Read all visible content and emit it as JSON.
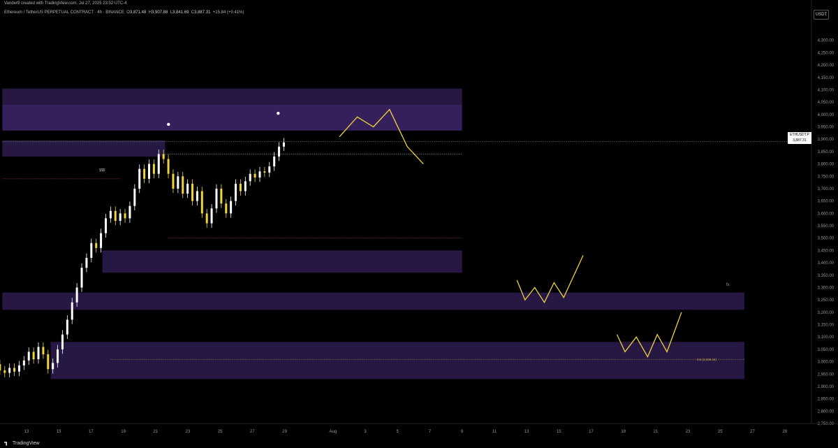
{
  "header": {
    "attribution": "Vander9 created with TradingView.com, Jul 27, 2025 23:02 UTC-4",
    "symbol_line": "Ethereum / TetherUS PERPETUAL CONTRACT · 4h · BINANCE",
    "open_label": "O",
    "open": "3,871.48",
    "high_label": "H",
    "high": "3,907.88",
    "low_label": "L",
    "low": "3,841.69",
    "close_label": "C",
    "close": "3,887.31",
    "change": "+15.84 (+0.41%)"
  },
  "currency": "USDT",
  "price_tag": {
    "symbol": "ETHUSDT.P",
    "price": "3,887.31",
    "countdown": "57:37"
  },
  "annotations": {
    "liquidity": "$$$",
    "fx": "fx",
    "fib": "0.5 (3,009.44)"
  },
  "brand": "TradingView",
  "colors": {
    "bull": "#ffffff",
    "bear": "#f0d43a",
    "zone": "#2a1a4a",
    "zone_light": "#3b2466",
    "path": "#f0d43a",
    "bg": "#000000"
  },
  "chart_data": {
    "type": "candlestick",
    "timeframe": "4h",
    "y_axis": {
      "min": 2750,
      "max": 4350,
      "ticks": [
        "4,300.00",
        "4,250.00",
        "4,200.00",
        "4,150.00",
        "4,100.00",
        "4,050.00",
        "4,000.00",
        "3,950.00",
        "3,900.00",
        "3,850.00",
        "3,800.00",
        "3,750.00",
        "3,700.00",
        "3,650.00",
        "3,600.00",
        "3,550.00",
        "3,500.00",
        "3,450.00",
        "3,400.00",
        "3,350.00",
        "3,300.00",
        "3,250.00",
        "3,200.00",
        "3,150.00",
        "3,100.00",
        "3,050.00",
        "3,000.00",
        "2,950.00",
        "2,900.00",
        "2,850.00",
        "2,800.00",
        "2,750.00"
      ]
    },
    "x_axis": {
      "ticks": [
        "13",
        "15",
        "17",
        "19",
        "21",
        "23",
        "25",
        "27",
        "29",
        "Aug",
        "3",
        "5",
        "7",
        "9",
        "11",
        "13",
        "15",
        "17",
        "19",
        "21",
        "23",
        "25",
        "27",
        "29"
      ],
      "tick_days": [
        12,
        14,
        16,
        18,
        20,
        22,
        24,
        26,
        28,
        31,
        33,
        35,
        37,
        39,
        41,
        43,
        45,
        47,
        49,
        51,
        53,
        55,
        57,
        59
      ]
    },
    "price_series": [
      [
        2990,
        2965
      ],
      [
        2965,
        2955
      ],
      [
        2955,
        2975
      ],
      [
        2975,
        2960
      ],
      [
        2960,
        2985
      ],
      [
        2985,
        3005
      ],
      [
        3005,
        3040
      ],
      [
        3040,
        3010
      ],
      [
        3010,
        3060
      ],
      [
        3060,
        3030
      ],
      [
        3030,
        2970
      ],
      [
        2970,
        2995
      ],
      [
        2995,
        3050
      ],
      [
        3050,
        3110
      ],
      [
        3110,
        3170
      ],
      [
        3170,
        3240
      ],
      [
        3240,
        3300
      ],
      [
        3300,
        3380
      ],
      [
        3380,
        3420
      ],
      [
        3420,
        3480
      ],
      [
        3480,
        3460
      ],
      [
        3460,
        3520
      ],
      [
        3520,
        3580
      ],
      [
        3580,
        3610
      ],
      [
        3610,
        3570
      ],
      [
        3570,
        3600
      ],
      [
        3600,
        3580
      ],
      [
        3580,
        3630
      ],
      [
        3630,
        3700
      ],
      [
        3700,
        3780
      ],
      [
        3780,
        3740
      ],
      [
        3740,
        3800
      ],
      [
        3800,
        3760
      ],
      [
        3760,
        3840
      ],
      [
        3840,
        3820
      ],
      [
        3820,
        3760
      ],
      [
        3760,
        3700
      ],
      [
        3700,
        3750
      ],
      [
        3750,
        3680
      ],
      [
        3680,
        3720
      ],
      [
        3720,
        3650
      ],
      [
        3650,
        3690
      ],
      [
        3690,
        3600
      ],
      [
        3600,
        3560
      ],
      [
        3560,
        3620
      ],
      [
        3620,
        3700
      ],
      [
        3700,
        3640
      ],
      [
        3640,
        3600
      ],
      [
        3600,
        3650
      ],
      [
        3650,
        3720
      ],
      [
        3720,
        3690
      ],
      [
        3690,
        3730
      ],
      [
        3730,
        3760
      ],
      [
        3760,
        3745
      ],
      [
        3745,
        3770
      ],
      [
        3770,
        3765
      ],
      [
        3765,
        3790
      ],
      [
        3790,
        3830
      ],
      [
        3830,
        3870
      ],
      [
        3870,
        3887
      ]
    ],
    "zones": [
      {
        "from_day": 10.5,
        "to_day": 39.0,
        "low": 4040,
        "high": 4105
      },
      {
        "from_day": 10.5,
        "to_day": 39.0,
        "low": 3935,
        "high": 4040,
        "shade": "light"
      },
      {
        "from_day": 10.5,
        "to_day": 20.6,
        "low": 3830,
        "high": 3895
      },
      {
        "from_day": 16.7,
        "to_day": 39.0,
        "low": 3360,
        "high": 3450
      },
      {
        "from_day": 10.5,
        "to_day": 56.5,
        "low": 3210,
        "high": 3280
      },
      {
        "from_day": 13.5,
        "to_day": 56.5,
        "low": 2930,
        "high": 3080
      }
    ],
    "projection_paths": [
      {
        "days": [
          31.4,
          32.5,
          33.5,
          34.5,
          35.6,
          36.6
        ],
        "prices": [
          3910,
          3990,
          3950,
          4020,
          3870,
          3800
        ]
      },
      {
        "days": [
          42.4,
          42.9,
          43.5,
          44.1,
          44.7,
          45.3,
          46.5
        ],
        "prices": [
          3330,
          3250,
          3300,
          3240,
          3320,
          3260,
          3430
        ]
      },
      {
        "days": [
          48.6,
          49.1,
          49.8,
          50.5,
          51.1,
          51.7,
          52.6
        ],
        "prices": [
          3110,
          3040,
          3100,
          3020,
          3110,
          3040,
          3200
        ]
      }
    ],
    "levels": [
      {
        "price": 3890,
        "from_day": 10.5,
        "to_day": 63,
        "style": "dotted"
      },
      {
        "price": 3840,
        "from_day": 20.6,
        "to_day": 39.0,
        "style": "dotted"
      },
      {
        "price": 3740,
        "from_day": 10.5,
        "to_day": 17.8,
        "style": "dotted-red"
      },
      {
        "price": 3500,
        "from_day": 20.8,
        "to_day": 39.0,
        "style": "dotted-red"
      },
      {
        "price": 3009.44,
        "from_day": 17.2,
        "to_day": 56.5,
        "style": "dotted-gold"
      }
    ],
    "markers": [
      {
        "day": 20.8,
        "price": 3960
      },
      {
        "day": 27.6,
        "price": 4005
      }
    ]
  }
}
